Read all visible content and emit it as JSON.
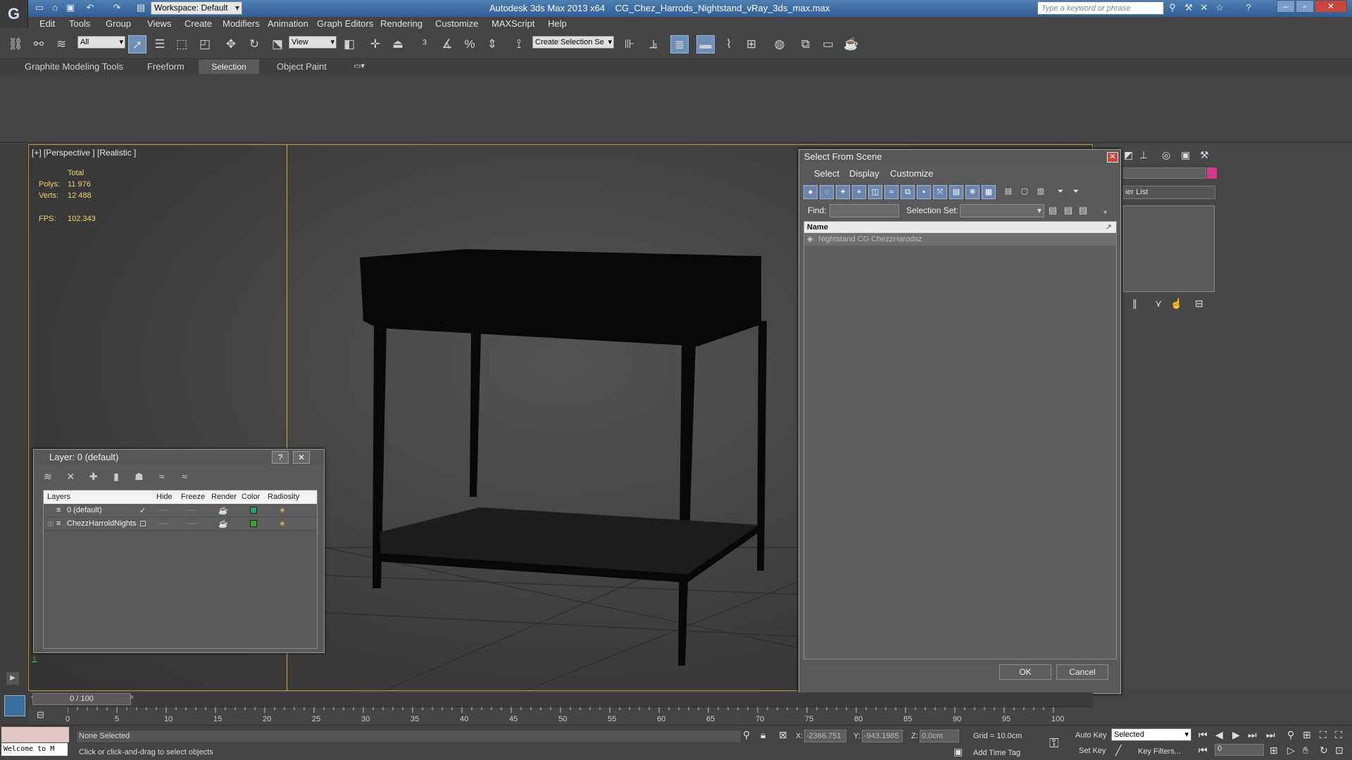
{
  "titlebar": {
    "workspace": "Workspace: Default",
    "app_title": "Autodesk 3ds Max  2013 x64",
    "file_name": "CG_Chez_Harrods_Nightstand_vRay_3ds_max.max",
    "search_placeholder": "Type a keyword or phrase"
  },
  "menu": [
    "Edit",
    "Tools",
    "Group",
    "Views",
    "Create",
    "Modifiers",
    "Animation",
    "Graph Editors",
    "Rendering",
    "Customize",
    "MAXScript",
    "Help"
  ],
  "toolbar": {
    "selection_filter": "All",
    "ref_coord": "View",
    "named_selection": "Create Selection Se"
  },
  "ribbon": {
    "tabs": [
      "Graphite Modeling Tools",
      "Freeform",
      "Selection",
      "Object Paint"
    ]
  },
  "viewport": {
    "label": "[+] [Perspective ] [Realistic ]",
    "stats_header": "Total",
    "polys_label": "Polys:",
    "polys_value": "11 976",
    "verts_label": "Verts:",
    "verts_value": "12 488",
    "fps_label": "FPS:",
    "fps_value": "102.343"
  },
  "layer_dialog": {
    "title": "Layer: 0 (default)",
    "help_btn": "?",
    "close_btn": "✕",
    "columns": [
      "Layers",
      "Hide",
      "Freeze",
      "Render",
      "Color",
      "Radiosity"
    ],
    "rows": [
      {
        "name": "0 (default)",
        "hide": "----",
        "freeze": "----",
        "color": "#2f9a6a"
      },
      {
        "name": "ChezzHarroldNights",
        "hide": "----",
        "freeze": "----",
        "color": "#3aa03a"
      }
    ]
  },
  "select_dialog": {
    "title": "Select From Scene",
    "close_btn": "✕",
    "menu": [
      "Select",
      "Display",
      "Customize"
    ],
    "find_label": "Find:",
    "selection_set_label": "Selection Set:",
    "list_header": "Name",
    "items": [
      "Nightstand CG ChezzHarodsz"
    ],
    "ok": "OK",
    "cancel": "Cancel"
  },
  "timeline": {
    "slider_label": "0 / 100",
    "ticks": [
      "0",
      "5",
      "10",
      "15",
      "20",
      "25",
      "30",
      "35",
      "40",
      "45",
      "50",
      "55",
      "60",
      "65",
      "70",
      "75",
      "80",
      "85",
      "90",
      "95",
      "100"
    ]
  },
  "status": {
    "welcome": "Welcome to M",
    "selection_status": "None Selected",
    "prompt": "Click or click-and-drag to select objects",
    "x_label": "X:",
    "x_value": "-2366.751",
    "y_label": "Y:",
    "y_value": "-943.1985",
    "z_label": "Z:",
    "z_value": "0.0cm",
    "grid": "Grid = 10.0cm",
    "add_time_tag": "Add Time Tag",
    "auto_key": "Auto Key",
    "set_key": "Set Key",
    "key_mode": "Selected",
    "key_filters": "Key Filters...",
    "frame": "0"
  },
  "right_panel": {
    "modifier_list": "ier List"
  },
  "colors": {
    "accent_blue": "#6b86ad",
    "viewport_border": "#b59d3c",
    "stats_yellow": "#f0d66a"
  }
}
